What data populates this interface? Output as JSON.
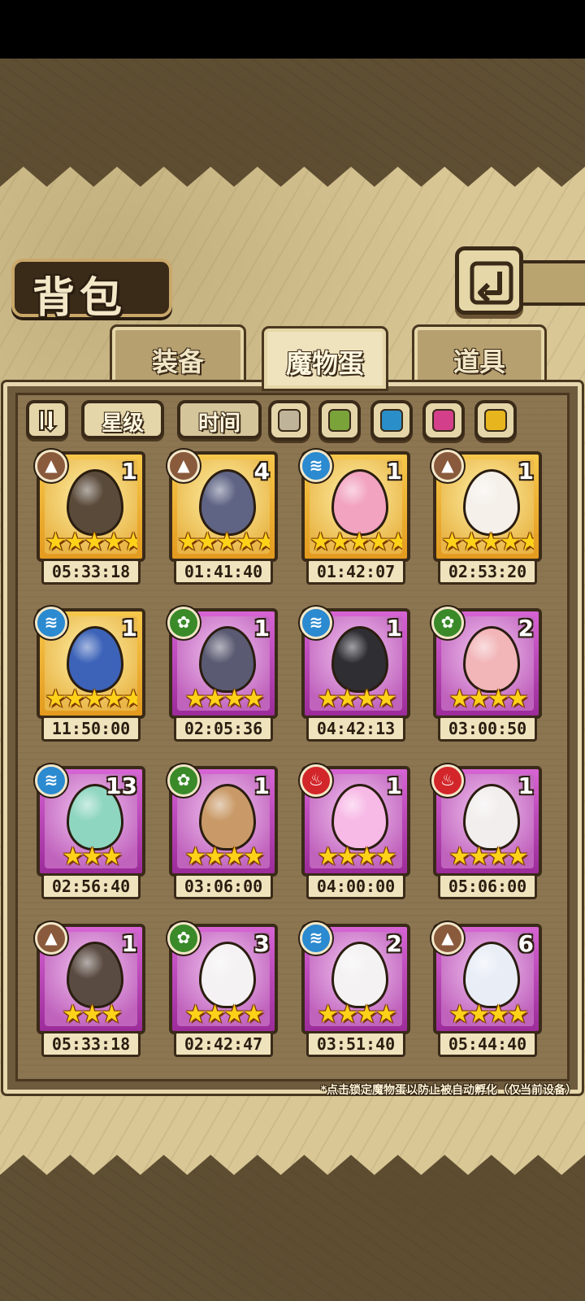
{
  "header": {
    "title": "背包",
    "back_icon": "back-arrow-icon"
  },
  "tabs": [
    {
      "label": "装备",
      "active": false
    },
    {
      "label": "魔物蛋",
      "active": true
    },
    {
      "label": "道具",
      "active": false
    }
  ],
  "filters": {
    "sort_icon": "sort-toggle-icon",
    "star_label": "星级",
    "time_label": "时间",
    "colors": [
      "#bfb39a",
      "#7aa33a",
      "#2a8fc9",
      "#d33f8a",
      "#e7b51e"
    ]
  },
  "eggs": [
    {
      "count": "1",
      "time": "05:33:18",
      "stars": "★★★★★",
      "element": "earth",
      "rarity": "gold",
      "egg_color": "#5a4a3a"
    },
    {
      "count": "4",
      "time": "01:41:40",
      "stars": "★★★★★",
      "element": "earth",
      "rarity": "gold",
      "egg_color": "#5f6484"
    },
    {
      "count": "1",
      "time": "01:42:07",
      "stars": "★★★★★",
      "element": "water",
      "rarity": "gold",
      "egg_color": "#f2a3c0"
    },
    {
      "count": "1",
      "time": "02:53:20",
      "stars": "★★★★★",
      "element": "earth",
      "rarity": "gold",
      "egg_color": "#f5f0ea"
    },
    {
      "count": "1",
      "time": "11:50:00",
      "stars": "★★★★★",
      "element": "water",
      "rarity": "gold",
      "egg_color": "#3c63b8"
    },
    {
      "count": "1",
      "time": "02:05:36",
      "stars": "★★★★",
      "element": "grass",
      "rarity": "purple",
      "egg_color": "#5a5a72"
    },
    {
      "count": "1",
      "time": "04:42:13",
      "stars": "★★★★",
      "element": "water",
      "rarity": "purple",
      "egg_color": "#2e2e33"
    },
    {
      "count": "2",
      "time": "03:00:50",
      "stars": "★★★★",
      "element": "grass",
      "rarity": "purple",
      "egg_color": "#f2b5b8"
    },
    {
      "count": "13",
      "time": "02:56:40",
      "stars": "★★★",
      "element": "water",
      "rarity": "purple",
      "egg_color": "#8fd6c0"
    },
    {
      "count": "1",
      "time": "03:06:00",
      "stars": "★★★★",
      "element": "grass",
      "rarity": "purple",
      "egg_color": "#c99a68"
    },
    {
      "count": "1",
      "time": "04:00:00",
      "stars": "★★★★",
      "element": "fire",
      "rarity": "purple",
      "egg_color": "#f7b9e6"
    },
    {
      "count": "1",
      "time": "05:06:00",
      "stars": "★★★★",
      "element": "fire",
      "rarity": "purple",
      "egg_color": "#f2eeee"
    },
    {
      "count": "1",
      "time": "05:33:18",
      "stars": "★★★",
      "element": "earth",
      "rarity": "purple",
      "egg_color": "#5a4b42"
    },
    {
      "count": "3",
      "time": "02:42:47",
      "stars": "★★★★",
      "element": "grass",
      "rarity": "purple",
      "egg_color": "#f4f2f2"
    },
    {
      "count": "2",
      "time": "03:51:40",
      "stars": "★★★★",
      "element": "water",
      "rarity": "purple",
      "egg_color": "#f4f2f2"
    },
    {
      "count": "6",
      "time": "05:44:40",
      "stars": "★★★★",
      "element": "earth",
      "rarity": "purple",
      "egg_color": "#e9eef6"
    }
  ],
  "element_colors": {
    "earth": "#8a5a3c",
    "water": "#2b8ad0",
    "grass": "#3a8a2a",
    "fire": "#d2262a"
  },
  "element_glyphs": {
    "earth": "▲",
    "water": "≋",
    "grass": "✿",
    "fire": "♨"
  },
  "footnote": "*点击锁定魔物蛋以防止被自动孵化（仅当前设备）"
}
